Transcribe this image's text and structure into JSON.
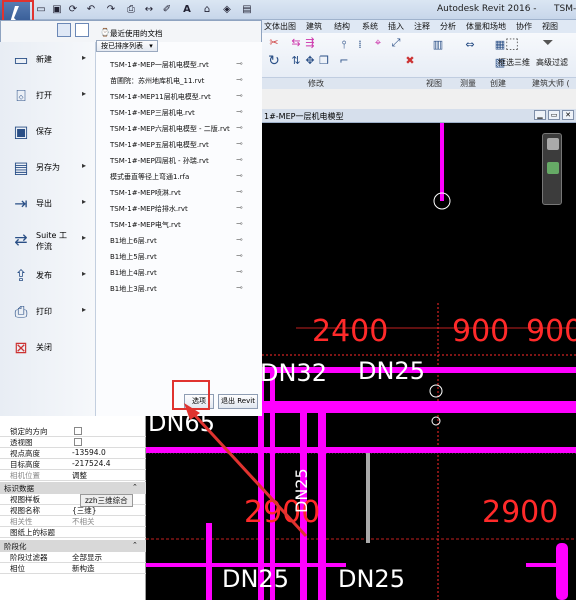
{
  "titlebar": {
    "app_title": "Autodesk Revit 2016 -",
    "doc_title": "TSM-"
  },
  "ribbon": {
    "tabs": [
      "文",
      "文",
      "文",
      "文",
      "文",
      "文",
      "文",
      "文",
      "文"
    ],
    "tab_labels": [
      "文",
      "文"
    ],
    "tab_list": [
      "文"
    ],
    "tab_names": [
      "文体出图",
      "建筑",
      "结构",
      "系统",
      "插入",
      "注释",
      "分析",
      "体量和场地",
      "协作",
      "视图"
    ],
    "panels": [
      "修改",
      "视图",
      "测量",
      "创建",
      "建筑大师 ("
    ],
    "buttons": [
      "框选三维",
      "高级过滤"
    ]
  },
  "menu": {
    "recent_title": "最近使用的文档",
    "sort_label": "按已排序列表",
    "items": [
      {
        "label": "新建"
      },
      {
        "label": "打开"
      },
      {
        "label": "保存"
      },
      {
        "label": "另存为"
      },
      {
        "label": "导出"
      },
      {
        "label": "Suite 工作流"
      },
      {
        "label": "发布"
      },
      {
        "label": "打印"
      },
      {
        "label": "关闭"
      }
    ],
    "recent_files": [
      "TSM-1#-MEP一层机电模型.rvt",
      "苗圃院：苏州地库机电_11.rvt",
      "TSM-1#-MEP11层机电模型.rvt",
      "TSM-1#-MEP三层机电.rvt",
      "TSM-1#-MEP六层机电模型 - 二版.rvt",
      "TSM-1#-MEP五层机电模型.rvt",
      "TSM-1#-MEP四层机 - 孙瑞.rvt",
      "模式垂直等径上弯通1.rfa",
      "TSM-1#-MEP喷淋.rvt",
      "TSM-1#-MEP给排水.rvt",
      "TSM-1#-MEP电气.rvt",
      "B1地上6层.rvt",
      "B1地上5层.rvt",
      "B1地上4层.rvt",
      "B1地上3层.rvt"
    ],
    "options_label": "选项",
    "exit_label": "退出 Revit"
  },
  "view": {
    "title": "1#-MEP一层机电模型",
    "dims": [
      "2400",
      "900",
      "900",
      "2900",
      "2900"
    ],
    "pipes": [
      "DN32",
      "DN25",
      "DN65",
      "DN25",
      "DN25",
      "DN25"
    ]
  },
  "properties": {
    "rows": [
      {
        "k": "锁定的方向",
        "v": "",
        "check": true
      },
      {
        "k": "透视图",
        "v": "",
        "check": true
      },
      {
        "k": "视点高度",
        "v": "-13594.0"
      },
      {
        "k": "目标高度",
        "v": "-217524.4"
      },
      {
        "k": "相机位置",
        "v": "调整"
      }
    ],
    "section_id": "标识数据",
    "rows2": [
      {
        "k": "视图样板",
        "v": "zzh三维综合"
      },
      {
        "k": "视图名称",
        "v": "{三维}"
      },
      {
        "k": "相关性",
        "v": "不相关"
      },
      {
        "k": "图纸上的标题",
        "v": ""
      }
    ],
    "section_phase": "阶段化",
    "rows3": [
      {
        "k": "阶段过滤器",
        "v": "全部显示"
      },
      {
        "k": "相位",
        "v": "新构造"
      }
    ]
  },
  "colors": {
    "pipe": "#ff00ff",
    "dim": "#ff2a2a",
    "highlight": "#e0332f"
  }
}
